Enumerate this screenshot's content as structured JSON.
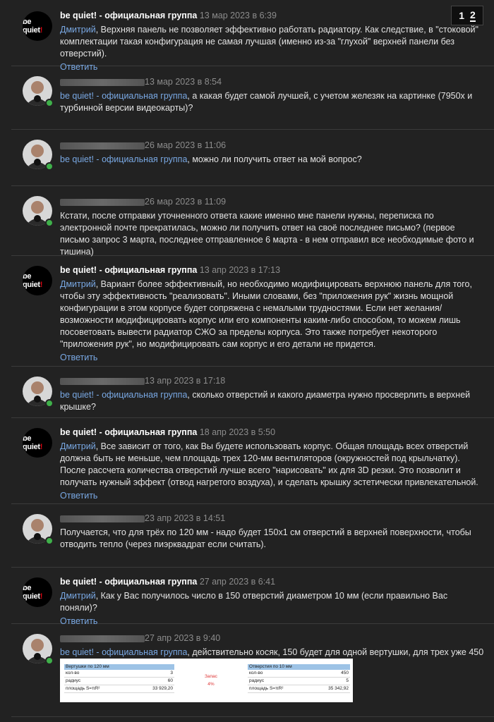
{
  "pagination": {
    "pages": [
      "1",
      "2"
    ],
    "current": "2"
  },
  "reply_label": "Ответить",
  "posts": [
    {
      "author": "be quiet! - официальная группа",
      "date": "13 мар 2023 в 6:39",
      "mention": "Дмитрий",
      "text": ", Верхняя панель не позволяет эффективно работать радиатору. Как следствие, в \"стоковой\" комплектации такая конфигурация не самая лучшая (именно из-за \"глухой\" верхней панели без отверстий)."
    },
    {
      "date": "13 мар 2023 в 8:54",
      "mention": "be quiet! - официальная группа",
      "text": ", а какая будет самой лучшей, с учетом железяк на картинке (7950х и турбинной версии видеокарты)?"
    },
    {
      "date": "26 мар 2023 в 11:06",
      "mention": "be quiet! - официальная группа",
      "text": ", можно ли получить ответ на мой вопрос?"
    },
    {
      "date": "26 мар 2023 в 11:09",
      "text": "Кстати, после отправки уточненного ответа какие именно мне панели нужны, переписка по электронной почте прекратилась, можно ли получить ответ на своё последнее письмо? (первое письмо запрос 3 марта, последнее отправленное 6 марта - в нем отправил все необходимые фото и тишина)"
    },
    {
      "author": "be quiet! - официальная группа",
      "date": "13 апр 2023 в 17:13",
      "mention": "Дмитрий",
      "text": ", Вариант более эффективный, но необходимо модифицировать верхнюю панель для того, чтобы эту эффективность \"реализовать\". Иными словами, без \"приложения рук\" жизнь мощной конфигурации в этом корпусе будет сопряжена с немалыми трудностями. Если нет желания/возможности модифицировать корпус или его компоненты каким-либо способом, то можем лишь посоветовать вывести радиатор СЖО за пределы корпуса. Это также потребует некоторого \"приложения рук\", но модифицировать сам корпус и его детали не придется."
    },
    {
      "date": "13 апр 2023 в 17:18",
      "mention": "be quiet! - официальная группа",
      "text": ", сколько отверстий и какого диаметра нужно просверлить в верхней крышке?"
    },
    {
      "author": "be quiet! - официальная группа",
      "date": "18 апр 2023 в 5:50",
      "mention": "Дмитрий",
      "text": ", Все зависит от того, как Вы будете использовать корпус. Общая площадь всех отверстий должна быть не меньше, чем площадь трех 120-мм вентиляторов (окружностей под крыльчатку).",
      "text2": "После рассчета количества отверстий лучше всего \"нарисовать\" их для 3D резки. Это позволит и получать нужный эффект (отвод нагретого воздуха), и сделать крышку эстетически привлекательной."
    },
    {
      "date": "23 апр 2023 в 14:51",
      "text": "Получается, что для трёх по 120 мм - надо будет 150х1 см отверстий в верхней поверхности, чтобы отводить тепло (через пиэрквадрат если считать)."
    },
    {
      "author": "be quiet! - официальная группа",
      "date": "27 апр 2023 в 6:41",
      "mention": "Дмитрий",
      "text": ", Как у Вас получилось число в 150 отверстий диаметром 10 мм (если правильно Вас поняли)?"
    },
    {
      "date": "27 апр 2023 в 9:40",
      "mention": "be quiet! - официальная группа",
      "text": ", действительно косяк, 150 будет для одной вертушки, для трех уже 450"
    }
  ],
  "attachment": {
    "left": {
      "title": "Вертушки по 120 мм",
      "rows": [
        [
          "кол-во",
          "3"
        ],
        [
          "радиус",
          "60"
        ],
        [
          "площадь S=πR²",
          "33 929,20"
        ]
      ]
    },
    "middle": {
      "label": "Запас",
      "value": "4%"
    },
    "right": {
      "title": "Отверстия по 10 мм",
      "rows": [
        [
          "кол-во",
          "450"
        ],
        [
          "радиус",
          "5"
        ],
        [
          "площадь S=πR²",
          "35 342,92"
        ]
      ]
    }
  },
  "colors": {
    "background": "#222222",
    "link": "#79a8e3",
    "online": "#3fb04a",
    "brand_red": "#e30613"
  }
}
